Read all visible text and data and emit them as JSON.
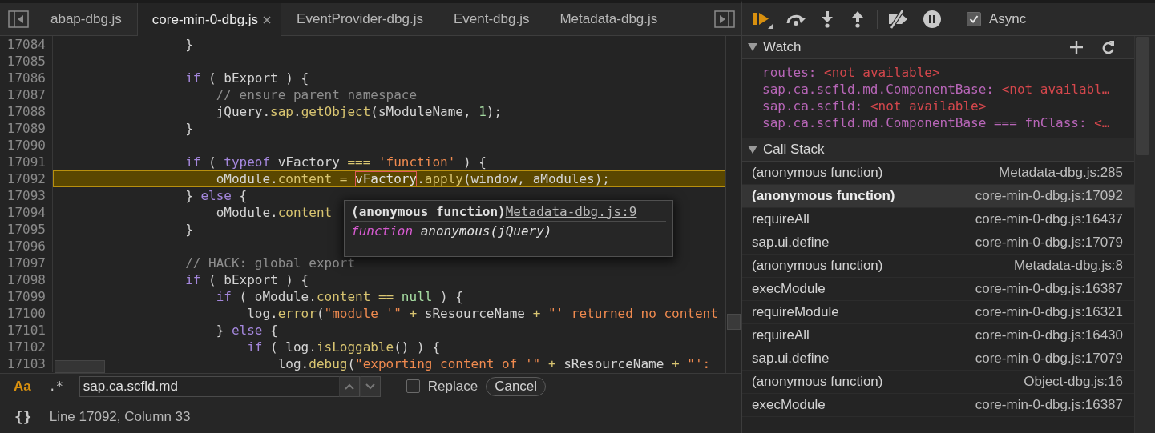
{
  "editor_tabs": [
    {
      "label": "abap-dbg.js",
      "selected": false
    },
    {
      "label": "core-min-0-dbg.js",
      "selected": true
    },
    {
      "label": "EventProvider-dbg.js",
      "selected": false
    },
    {
      "label": "Event-dbg.js",
      "selected": false
    },
    {
      "label": "Metadata-dbg.js",
      "selected": false
    }
  ],
  "code": {
    "lines": [
      {
        "number": "17084",
        "current": false,
        "tokens": [
          {
            "text": "                }",
            "kind": "plain"
          }
        ]
      },
      {
        "number": "17085",
        "current": false
      },
      {
        "number": "17086",
        "current": false,
        "tokens": [
          {
            "text": "                if",
            "kind": "kw"
          },
          {
            "text": " ( bExport ) {",
            "kind": "plain"
          }
        ]
      },
      {
        "number": "17087",
        "current": false,
        "tokens": [
          {
            "text": "                    // ensure parent namespace",
            "kind": "comment"
          }
        ]
      },
      {
        "number": "17088",
        "current": false,
        "tokens": [
          {
            "text": "                    jQuery.",
            "kind": "plain"
          },
          {
            "text": "sap",
            "kind": "prop"
          },
          {
            "text": ".",
            "kind": "plain"
          },
          {
            "text": "getObject",
            "kind": "prop"
          },
          {
            "text": "(sModuleName, ",
            "kind": "plain"
          },
          {
            "text": "1",
            "kind": "num"
          },
          {
            "text": ");",
            "kind": "plain"
          }
        ]
      },
      {
        "number": "17089",
        "current": false,
        "tokens": [
          {
            "text": "                }",
            "kind": "plain"
          }
        ]
      },
      {
        "number": "17090",
        "current": false
      },
      {
        "number": "17091",
        "current": false,
        "tokens": [
          {
            "text": "                if",
            "kind": "kw"
          },
          {
            "text": " ( ",
            "kind": "plain"
          },
          {
            "text": "typeof",
            "kind": "kw"
          },
          {
            "text": " vFactory ",
            "kind": "plain"
          },
          {
            "text": "=== ",
            "kind": "op"
          },
          {
            "text": "'function'",
            "kind": "str"
          },
          {
            "text": " ) {",
            "kind": "plain"
          }
        ]
      },
      {
        "number": "17092",
        "current": true,
        "tokens": [
          {
            "text": "                    oModule.",
            "kind": "plain"
          },
          {
            "text": "content",
            "kind": "prop"
          },
          {
            "text": " = ",
            "kind": "op"
          },
          {
            "text": "vFactory",
            "kind": "match"
          },
          {
            "text": ".",
            "kind": "plain"
          },
          {
            "text": "apply",
            "kind": "prop"
          },
          {
            "text": "(window, aModules);",
            "kind": "plain"
          }
        ]
      },
      {
        "number": "17093",
        "current": false,
        "tokens": [
          {
            "text": "                } ",
            "kind": "plain"
          },
          {
            "text": "else",
            "kind": "kw"
          },
          {
            "text": " {",
            "kind": "plain"
          }
        ]
      },
      {
        "number": "17094",
        "current": false,
        "tokens": [
          {
            "text": "                    oModule.",
            "kind": "plain"
          },
          {
            "text": "content",
            "kind": "prop"
          }
        ]
      },
      {
        "number": "17095",
        "current": false,
        "tokens": [
          {
            "text": "                }",
            "kind": "plain"
          }
        ]
      },
      {
        "number": "17096",
        "current": false
      },
      {
        "number": "17097",
        "current": false,
        "tokens": [
          {
            "text": "                // HACK: global export",
            "kind": "comment"
          }
        ]
      },
      {
        "number": "17098",
        "current": false,
        "tokens": [
          {
            "text": "                if",
            "kind": "kw"
          },
          {
            "text": " ( bExport ) {",
            "kind": "plain"
          }
        ]
      },
      {
        "number": "17099",
        "current": false,
        "tokens": [
          {
            "text": "                    if",
            "kind": "kw"
          },
          {
            "text": " ( oModule.",
            "kind": "plain"
          },
          {
            "text": "content",
            "kind": "prop"
          },
          {
            "text": " == ",
            "kind": "op"
          },
          {
            "text": "null",
            "kind": "num"
          },
          {
            "text": " ) {",
            "kind": "plain"
          }
        ]
      },
      {
        "number": "17100",
        "current": false,
        "tokens": [
          {
            "text": "                        log.",
            "kind": "plain"
          },
          {
            "text": "error",
            "kind": "prop"
          },
          {
            "text": "(",
            "kind": "plain"
          },
          {
            "text": "\"module '\"",
            "kind": "str"
          },
          {
            "text": " + ",
            "kind": "op"
          },
          {
            "text": "sResourceName",
            "kind": "plain"
          },
          {
            "text": " + ",
            "kind": "op"
          },
          {
            "text": "\"' returned no content",
            "kind": "str"
          }
        ]
      },
      {
        "number": "17101",
        "current": false,
        "tokens": [
          {
            "text": "                    } ",
            "kind": "plain"
          },
          {
            "text": "else",
            "kind": "kw"
          },
          {
            "text": " {",
            "kind": "plain"
          }
        ]
      },
      {
        "number": "17102",
        "current": false,
        "tokens": [
          {
            "text": "                        if",
            "kind": "kw"
          },
          {
            "text": " ( log.",
            "kind": "plain"
          },
          {
            "text": "isLoggable",
            "kind": "prop"
          },
          {
            "text": "() ) {",
            "kind": "plain"
          }
        ]
      },
      {
        "number": "17103",
        "current": false,
        "tokens": [
          {
            "text": "                            log.",
            "kind": "plain"
          },
          {
            "text": "debug",
            "kind": "prop"
          },
          {
            "text": "(",
            "kind": "plain"
          },
          {
            "text": "\"exporting content of '\"",
            "kind": "str"
          },
          {
            "text": " + ",
            "kind": "op"
          },
          {
            "text": "sResourceName",
            "kind": "plain"
          },
          {
            "text": " + ",
            "kind": "op"
          },
          {
            "text": "\"':",
            "kind": "str"
          }
        ]
      }
    ]
  },
  "tooltip": {
    "title": "(anonymous function)",
    "link": "Metadata-dbg.js:9",
    "keyword": "function",
    "signature": "anonymous(jQuery)"
  },
  "search": {
    "case_label": "Aa",
    "case_sensitive": true,
    "regex_label": ".*",
    "regex": false,
    "value": "sap.ca.scfld.md",
    "replace_label": "Replace",
    "replace_checked": false,
    "cancel_label": "Cancel"
  },
  "status_bar": {
    "format_label": "{}",
    "position": "Line 17092, Column 33"
  },
  "debugger_toolbar": {
    "async_label": "Async",
    "async_checked": true
  },
  "watch": {
    "title": "Watch",
    "expanded": true,
    "items": [
      {
        "name": "routes:",
        "value": "<not available>"
      },
      {
        "name": "sap.ca.scfld.md.ComponentBase:",
        "value": "<not availabl…"
      },
      {
        "name": "sap.ca.scfld:",
        "value": "<not available>"
      },
      {
        "name": "sap.ca.scfld.md.ComponentBase === fnClass:",
        "value": "<…"
      }
    ]
  },
  "call_stack": {
    "title": "Call Stack",
    "expanded": true,
    "frames": [
      {
        "function": "(anonymous function)",
        "location": "Metadata-dbg.js:285",
        "selected": false
      },
      {
        "function": "(anonymous function)",
        "location": "core-min-0-dbg.js:17092",
        "selected": true
      },
      {
        "function": "requireAll",
        "location": "core-min-0-dbg.js:16437",
        "selected": false
      },
      {
        "function": "sap.ui.define",
        "location": "core-min-0-dbg.js:17079",
        "selected": false
      },
      {
        "function": "(anonymous function)",
        "location": "Metadata-dbg.js:8",
        "selected": false
      },
      {
        "function": "execModule",
        "location": "core-min-0-dbg.js:16387",
        "selected": false
      },
      {
        "function": "requireModule",
        "location": "core-min-0-dbg.js:16321",
        "selected": false
      },
      {
        "function": "requireAll",
        "location": "core-min-0-dbg.js:16430",
        "selected": false
      },
      {
        "function": "sap.ui.define",
        "location": "core-min-0-dbg.js:17079",
        "selected": false
      },
      {
        "function": "(anonymous function)",
        "location": "Object-dbg.js:16",
        "selected": false
      },
      {
        "function": "execModule",
        "location": "core-min-0-dbg.js:16387",
        "selected": false
      }
    ]
  }
}
